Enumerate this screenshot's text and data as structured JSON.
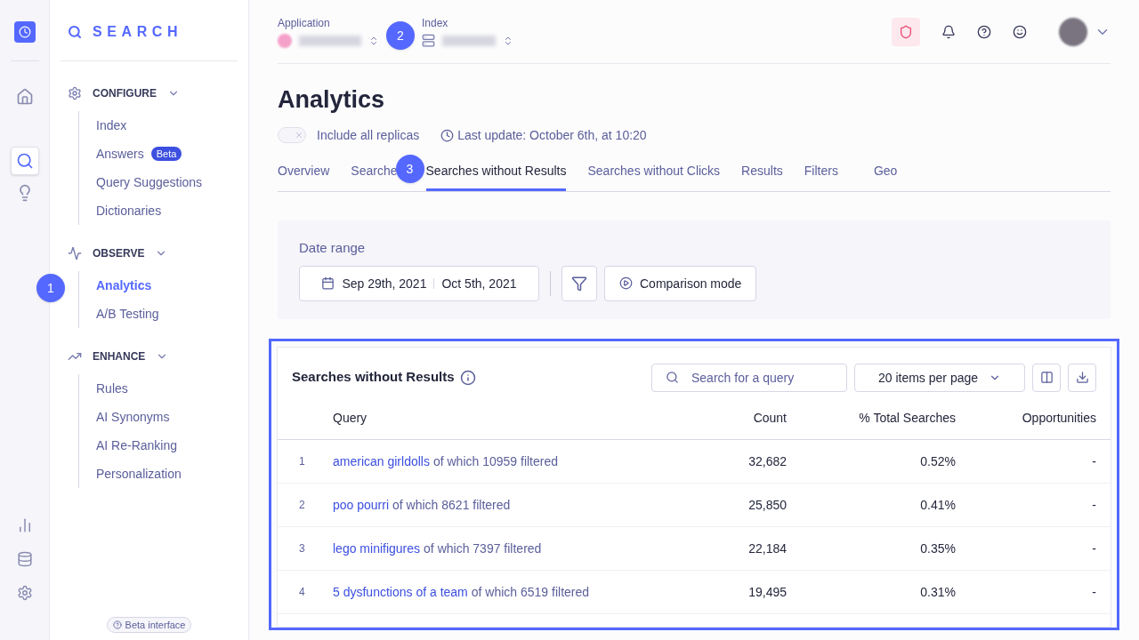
{
  "rail": {
    "items": [
      {
        "kind": "home",
        "selected": false
      },
      {
        "kind": "search",
        "selected": true
      },
      {
        "kind": "bulb",
        "selected": false
      }
    ],
    "bottom": [
      {
        "kind": "chart"
      },
      {
        "kind": "database"
      },
      {
        "kind": "settings"
      }
    ]
  },
  "sidebar": {
    "brand": "SEARCH",
    "sections": [
      {
        "kind": "gear",
        "title": "CONFIGURE",
        "items": [
          {
            "label": "Index",
            "selected": false
          },
          {
            "label": "Answers",
            "badge": "Beta",
            "selected": false
          },
          {
            "label": "Query Suggestions",
            "selected": false
          },
          {
            "label": "Dictionaries",
            "selected": false
          }
        ]
      },
      {
        "kind": "pulse",
        "title": "OBSERVE",
        "items": [
          {
            "label": "Analytics",
            "selected": true
          },
          {
            "label": "A/B Testing",
            "selected": false
          }
        ]
      },
      {
        "kind": "trend",
        "title": "ENHANCE",
        "items": [
          {
            "label": "Rules",
            "selected": false
          },
          {
            "label": "AI Synonyms",
            "selected": false
          },
          {
            "label": "AI Re-Ranking",
            "selected": false
          },
          {
            "label": "Personalization",
            "selected": false
          }
        ]
      }
    ],
    "footer": "Beta interface"
  },
  "header": {
    "application_label": "Application",
    "index_label": "Index"
  },
  "page": {
    "title": "Analytics",
    "replicas": {
      "label": "Include all replicas",
      "on": false
    },
    "last_update": "Last update: October 6th, at 10:20"
  },
  "tabs": [
    {
      "label": "Overview",
      "selected": false
    },
    {
      "label": "Searche",
      "selected": false
    },
    {
      "label": "Searches without Results",
      "selected": true
    },
    {
      "label": "Searches without Clicks",
      "selected": false
    },
    {
      "label": "Results",
      "selected": false
    },
    {
      "label": "Filters",
      "selected": false
    },
    {
      "label": "Geo",
      "selected": false
    }
  ],
  "date_range": {
    "label": "Date range",
    "start": "Sep 29th, 2021",
    "end": "Oct 5th, 2021",
    "comparison": "Comparison mode"
  },
  "table": {
    "title": "Searches without Results",
    "search_placeholder": "Search for a query",
    "per_page": "20 items per page",
    "columns": [
      "Query",
      "Count",
      "% Total Searches",
      "Opportunities"
    ],
    "rows": [
      {
        "rank": "1",
        "query": "american girldolls",
        "note": "of which 10959 filtered",
        "count": "32,682",
        "share": "0.52%",
        "opportunities": "-"
      },
      {
        "rank": "2",
        "query": "poo pourri",
        "note": "of which 8621 filtered",
        "count": "25,850",
        "share": "0.41%",
        "opportunities": "-"
      },
      {
        "rank": "3",
        "query": "lego minifigures",
        "note": "of which 7397 filtered",
        "count": "22,184",
        "share": "0.35%",
        "opportunities": "-"
      },
      {
        "rank": "4",
        "query": "5 dysfunctions of a team",
        "note": "of which 6519 filtered",
        "count": "19,495",
        "share": "0.31%",
        "opportunities": "-"
      }
    ]
  },
  "callouts": [
    "1",
    "2",
    "3"
  ]
}
